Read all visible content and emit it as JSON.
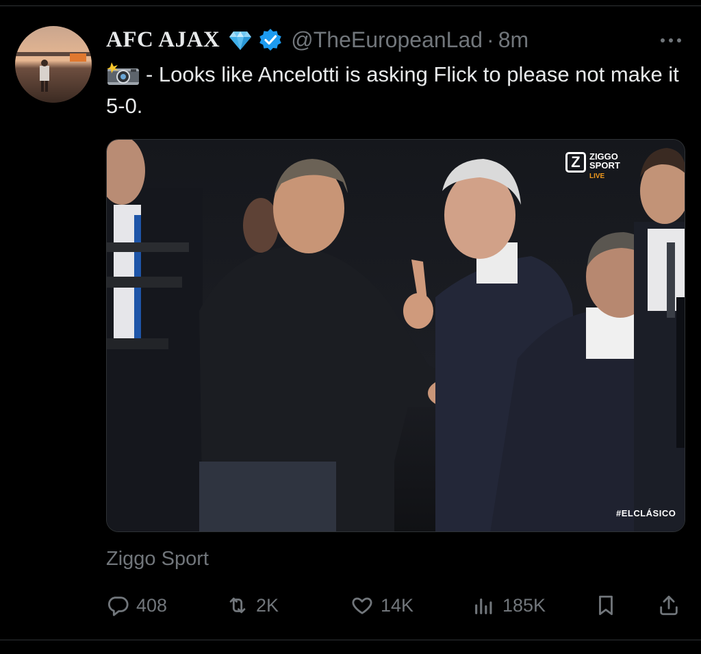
{
  "tweet": {
    "display_name": "AFC AJAX",
    "handle": "@TheEuropeanLad",
    "separator": "·",
    "time": "8m",
    "text": "- Looks like Ancelotti is asking Flick to please not make it 5-0.",
    "source": "Ziggo Sport"
  },
  "media": {
    "logo_line1": "ZIGGO",
    "logo_line2": "SPORT",
    "logo_live": "LIVE",
    "logo_letter": "Z",
    "hashtag": "#ELCLÁSICO"
  },
  "metrics": {
    "replies": "408",
    "retweets": "2K",
    "likes": "14K",
    "views": "185K"
  },
  "icons": {
    "diamond": "gem-icon",
    "verified": "verified-badge-icon",
    "camera": "camera-flash-icon",
    "reply": "reply-icon",
    "retweet": "retweet-icon",
    "like": "heart-icon",
    "views": "views-icon",
    "bookmark": "bookmark-icon",
    "share": "share-icon"
  },
  "colors": {
    "background": "#000000",
    "text": "#e7e9ea",
    "muted": "#71767b",
    "verified": "#1d9bf0",
    "ziggo_live": "#f29a1d"
  }
}
